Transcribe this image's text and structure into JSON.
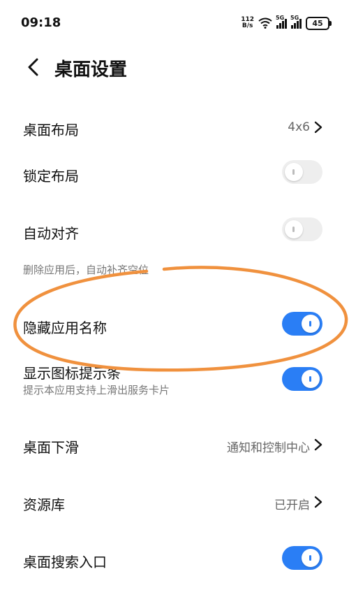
{
  "status_bar": {
    "time": "09:18",
    "net_speed_value": "112",
    "net_speed_unit": "B/s",
    "signal1_label": "5G",
    "signal2_label": "5G",
    "battery": "45"
  },
  "header": {
    "title": "桌面设置",
    "back_icon": "chevron-left-icon"
  },
  "settings": {
    "layout": {
      "label": "桌面布局",
      "value": "4x6"
    },
    "lock_layout": {
      "label": "锁定布局",
      "enabled": false
    },
    "auto_align": {
      "label": "自动对齐",
      "enabled": false,
      "description": "删除应用后，自动补齐空位"
    },
    "hide_app_names": {
      "label": "隐藏应用名称",
      "enabled": true
    },
    "show_icon_hint": {
      "label": "显示图标提示条",
      "description": "提示本应用支持上滑出服务卡片",
      "enabled": true
    },
    "swipe_down": {
      "label": "桌面下滑",
      "value": "通知和控制中心"
    },
    "app_library": {
      "label": "资源库",
      "value": "已开启"
    },
    "search_entry": {
      "label": "桌面搜索入口",
      "enabled": true
    }
  },
  "colors": {
    "accent": "#2a7ef5",
    "annotation": "#f0913e"
  }
}
